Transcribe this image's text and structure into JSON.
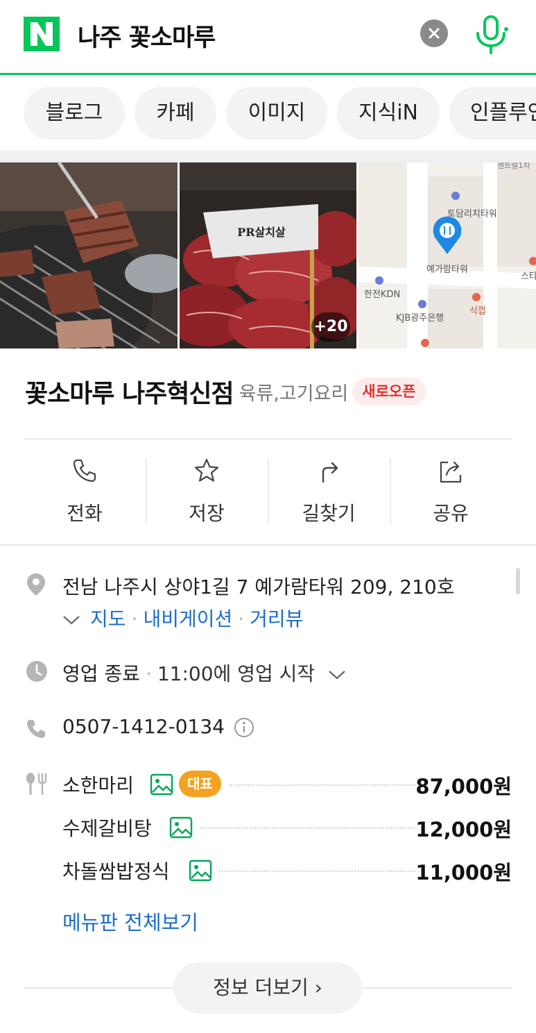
{
  "search": {
    "query": "나주 꽃소마루",
    "logo_color": "#03c75a"
  },
  "chips": [
    "블로그",
    "카페",
    "이미지",
    "지식iN",
    "인플루언"
  ],
  "photos": {
    "more_count": "+20",
    "map_labels": {
      "tower1": "토담리치타워",
      "tower2": "예가람타워",
      "kdn": "한전KDN",
      "bank": "KJB광주은행",
      "diner": "식껍",
      "edge": "스타",
      "top": "센트럴1차"
    },
    "flag_text": "PR살치살"
  },
  "place": {
    "name": "꽃소마루 나주혁신점",
    "category": "육류,고기요리",
    "badge": "새로오픈"
  },
  "actions": [
    {
      "label": "전화",
      "icon": "phone-icon"
    },
    {
      "label": "저장",
      "icon": "star-icon"
    },
    {
      "label": "길찾기",
      "icon": "directions-icon"
    },
    {
      "label": "공유",
      "icon": "share-icon"
    }
  ],
  "info": {
    "address": "전남 나주시 상야1길 7 예가람타워 209, 210호",
    "links": [
      "지도",
      "내비게이션",
      "거리뷰"
    ],
    "status": "영업 종료",
    "hours": "11:00에 영업 시작",
    "phone": "0507-1412-0134"
  },
  "menu": {
    "rep_badge": "대표",
    "items": [
      {
        "name": "소한마리",
        "price": "87,000원"
      },
      {
        "name": "수제갈비탕",
        "price": "12,000원"
      },
      {
        "name": "차돌쌈밥정식",
        "price": "11,000원"
      }
    ],
    "see_all": "메뉴판 전체보기"
  },
  "more_button": "정보 더보기 ›",
  "colors": {
    "accent_green": "#03c75a",
    "link_blue": "#1a6dcc",
    "new_badge_red": "#e03131",
    "rep_badge_orange": "#f4a21f"
  }
}
